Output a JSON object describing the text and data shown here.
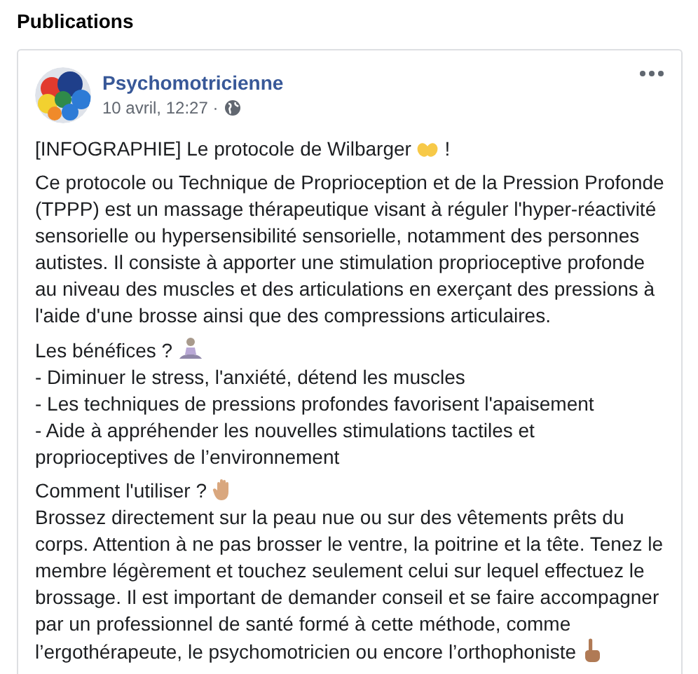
{
  "section_title": "Publications",
  "post": {
    "author": "Psychomotricienne",
    "date": "10 avril, 12:27 ·",
    "headline": {
      "text": "[INFOGRAPHIE] Le protocole de Wilbarger",
      "suffix": "!"
    },
    "intro": "Ce protocole ou Technique de Proprioception et de la Pression Profonde (TPPP) est un massage thérapeutique visant à réguler l'hyper-réactivité sensorielle ou hypersensibilité sensorielle, notamment des personnes autistes. Il consiste à apporter une stimulation proprioceptive profonde au niveau des muscles et des articulations en exerçant des pressions à l'aide d'une brosse ainsi que des compressions articulaires.",
    "benefits": {
      "heading": "Les bénéfices ?",
      "items": [
        "- Diminuer le stress, l'anxiété, détend les muscles",
        "- Les techniques de pressions profondes favorisent l'apaisement",
        "- Aide à appréhender les nouvelles stimulations tactiles et proprioceptives de l’environnement"
      ]
    },
    "usage": {
      "heading": "Comment l'utiliser ?",
      "lines": [
        "Brossez directement sur la peau nue ou sur des vêtements prêts du",
        "corps. Attention à ne pas brosser le ventre, la poitrine et la tête. Tenez le",
        "membre légèrement et touchez seulement celui sur lequel effectuez le",
        "brossage. Il est important de demander conseil et se faire accompagner",
        "par un professionnel de santé formé à cette méthode, comme",
        "l’ergothérapeute, le psychomotricien ou encore l’orthophoniste"
      ]
    }
  }
}
